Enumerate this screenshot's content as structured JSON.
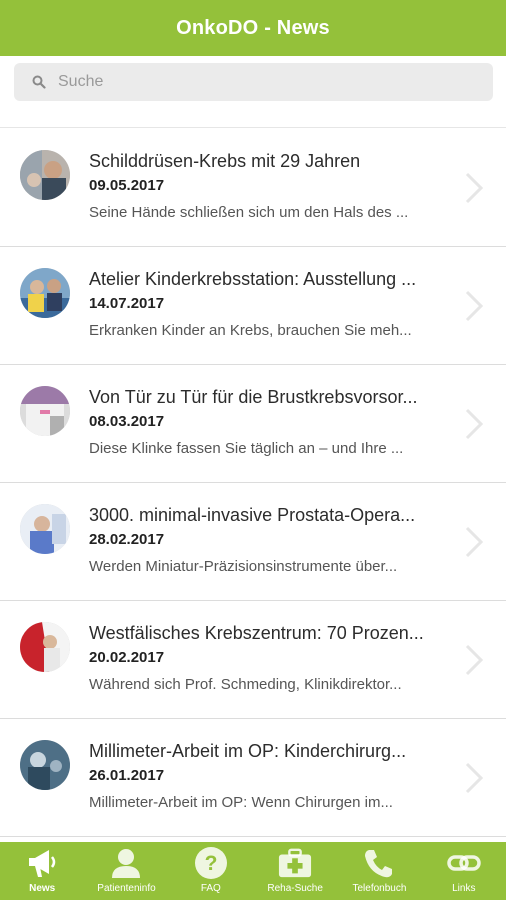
{
  "header": {
    "title": "OnkoDO - News"
  },
  "search": {
    "placeholder": "Suche",
    "value": ""
  },
  "news": [
    {
      "title": "Schilddrüsen-Krebs mit 29 Jahren",
      "date": "09.05.2017",
      "excerpt": "Seine Hände schließen sich um den Hals des ..."
    },
    {
      "title": "Atelier Kinderkrebsstation: Ausstellung ...",
      "date": "14.07.2017",
      "excerpt": "Erkranken Kinder an Krebs, brauchen Sie meh..."
    },
    {
      "title": "Von Tür zu Tür für die Brustkrebsvorsor...",
      "date": "08.03.2017",
      "excerpt": "Diese Klinke fassen Sie täglich an – und Ihre ..."
    },
    {
      "title": "3000. minimal-invasive Prostata-Opera...",
      "date": "28.02.2017",
      "excerpt": "Werden Miniatur-Präzisionsinstrumente über..."
    },
    {
      "title": "Westfälisches Krebszentrum: 70 Prozen...",
      "date": "20.02.2017",
      "excerpt": "Während sich Prof. Schmeding, Klinikdirektor..."
    },
    {
      "title": "Millimeter-Arbeit im OP: Kinderchirurg...",
      "date": "26.01.2017",
      "excerpt": "Millimeter-Arbeit im OP: Wenn Chirurgen im..."
    }
  ],
  "tabs": [
    {
      "label": "News",
      "icon": "megaphone-icon",
      "active": true
    },
    {
      "label": "Patienteninfo",
      "icon": "person-icon",
      "active": false
    },
    {
      "label": "FAQ",
      "icon": "question-icon",
      "active": false
    },
    {
      "label": "Reha-Suche",
      "icon": "medical-kit-icon",
      "active": false
    },
    {
      "label": "Telefonbuch",
      "icon": "phone-icon",
      "active": false
    },
    {
      "label": "Links",
      "icon": "link-icon",
      "active": false
    }
  ],
  "colors": {
    "accent": "#94c13a",
    "tab_text": "#ffffff"
  }
}
